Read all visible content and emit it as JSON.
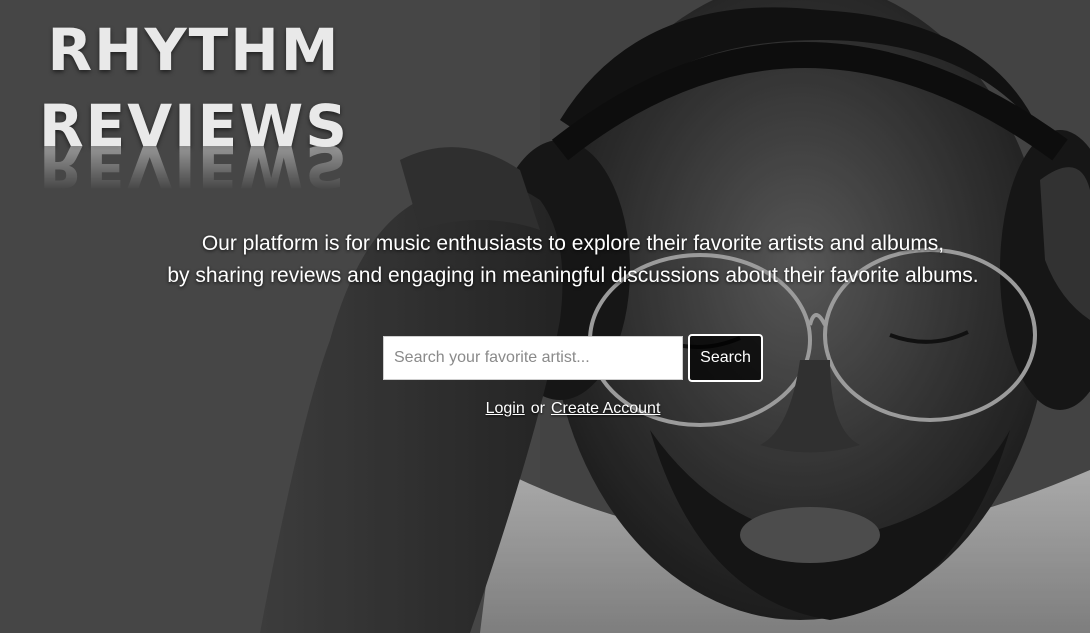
{
  "brand": {
    "line1": "RHYTHM",
    "line2": "REVIEWS"
  },
  "tagline": {
    "line1": "Our platform is for music enthusiasts to explore their favorite artists and albums,",
    "line2": "by sharing reviews and engaging in meaningful discussions about their favorite albums."
  },
  "search": {
    "placeholder": "Search your favorite artist...",
    "value": "",
    "button_label": "Search"
  },
  "auth": {
    "login_label": "Login",
    "separator": "or",
    "create_account_label": "Create Account"
  },
  "colors": {
    "text": "#ffffff",
    "button_border": "#ffffff",
    "input_background": "#ffffff"
  }
}
